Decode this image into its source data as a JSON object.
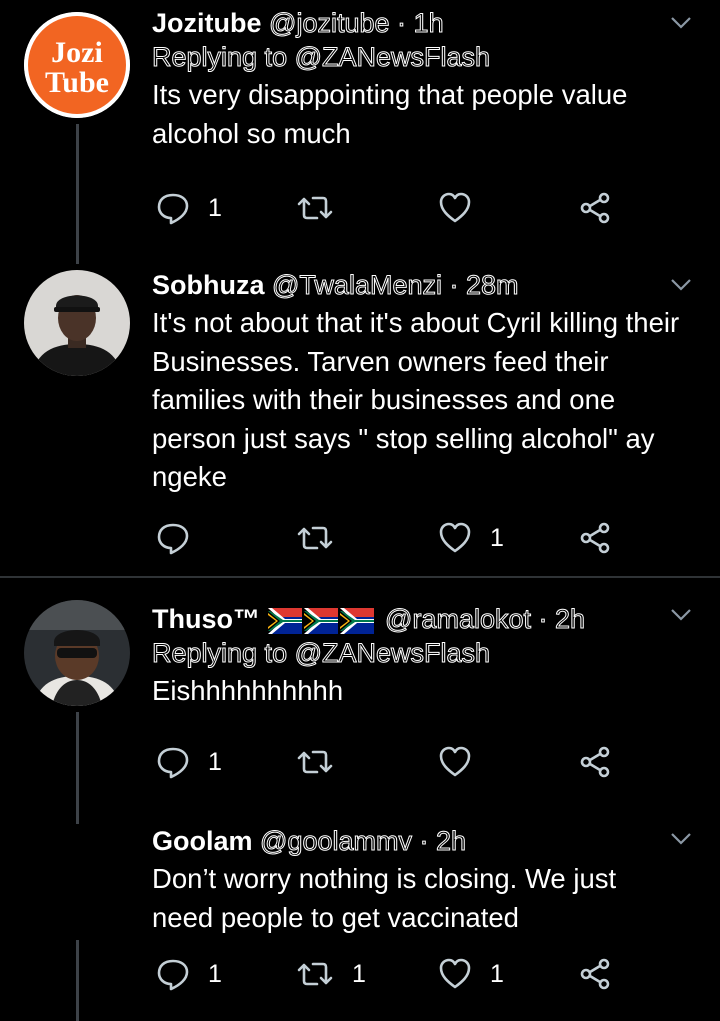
{
  "tweets": [
    {
      "name": "Jozitube",
      "handle": "@jozitube",
      "dot": "·",
      "time": "1h",
      "replying_prefix": "Replying to",
      "replying_to": "@ZANewsFlash",
      "text": "Its very disappointing that people value alcohol so much",
      "avatar_text_1": "Jozi",
      "avatar_text_2": "Tube",
      "reply_count": "1",
      "retweet_count": "",
      "like_count": ""
    },
    {
      "name": "Sobhuza",
      "handle": "@TwalaMenzi",
      "dot": "·",
      "time": "28m",
      "text": "It's not about that it's about Cyril  killing their Businesses. Tarven owners feed their families with their businesses and one person just says \" stop selling alcohol\" ay ngeke",
      "reply_count": "",
      "retweet_count": "",
      "like_count": "1"
    },
    {
      "name": "Thuso™",
      "handle": "@ramalokot",
      "dot": "·",
      "time": "2h",
      "replying_prefix": "Replying to",
      "replying_to": "@ZANewsFlash",
      "text": "Eishhhhhhhhhh",
      "reply_count": "1",
      "retweet_count": "",
      "like_count": ""
    },
    {
      "name": "Goolam",
      "handle": "@goolammv",
      "dot": "·",
      "time": "2h",
      "text": "Don’t worry nothing is closing. We just need people to get vaccinated",
      "reply_count": "1",
      "retweet_count": "1",
      "like_count": "1"
    }
  ],
  "colors": {
    "background": "#000000",
    "text": "#ffffff",
    "icon": "#c4cfd6",
    "divider": "#2f3336",
    "thread_line": "#3d4248",
    "jozitube_orange": "#f26522"
  },
  "icons": [
    "reply-icon",
    "retweet-icon",
    "like-icon",
    "share-icon",
    "chevron-down-icon",
    "south-africa-flag-icon"
  ]
}
